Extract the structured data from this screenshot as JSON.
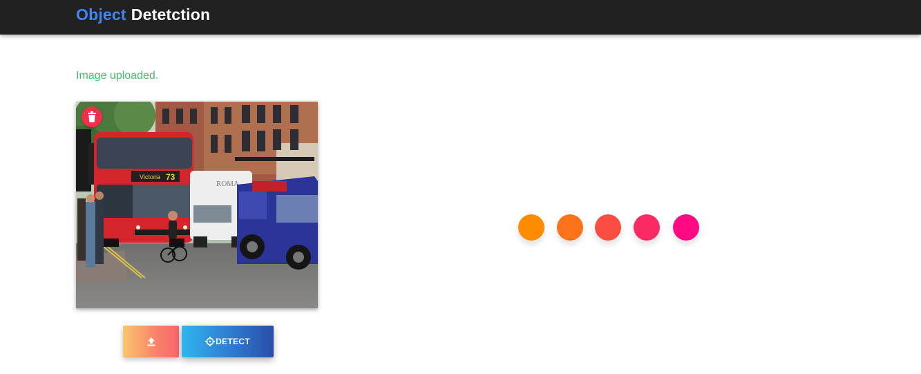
{
  "navbar": {
    "brand_part1": "Object",
    "brand_part2": "Detetction",
    "brand_part1_color": "#4285f4",
    "brand_part2_color": "#ffffff"
  },
  "status": {
    "message": "Image uploaded.",
    "color": "#3fbf6a"
  },
  "image_card": {
    "delete_icon": "trash-icon"
  },
  "actions": {
    "upload_icon": "upload-icon",
    "detect_icon": "crosshair-icon",
    "detect_label": "DETECT"
  },
  "loader": {
    "dot_colors": [
      "#ff8c00",
      "#fb7219",
      "#fb4d41",
      "#fb2a62",
      "#ff0a82"
    ]
  }
}
